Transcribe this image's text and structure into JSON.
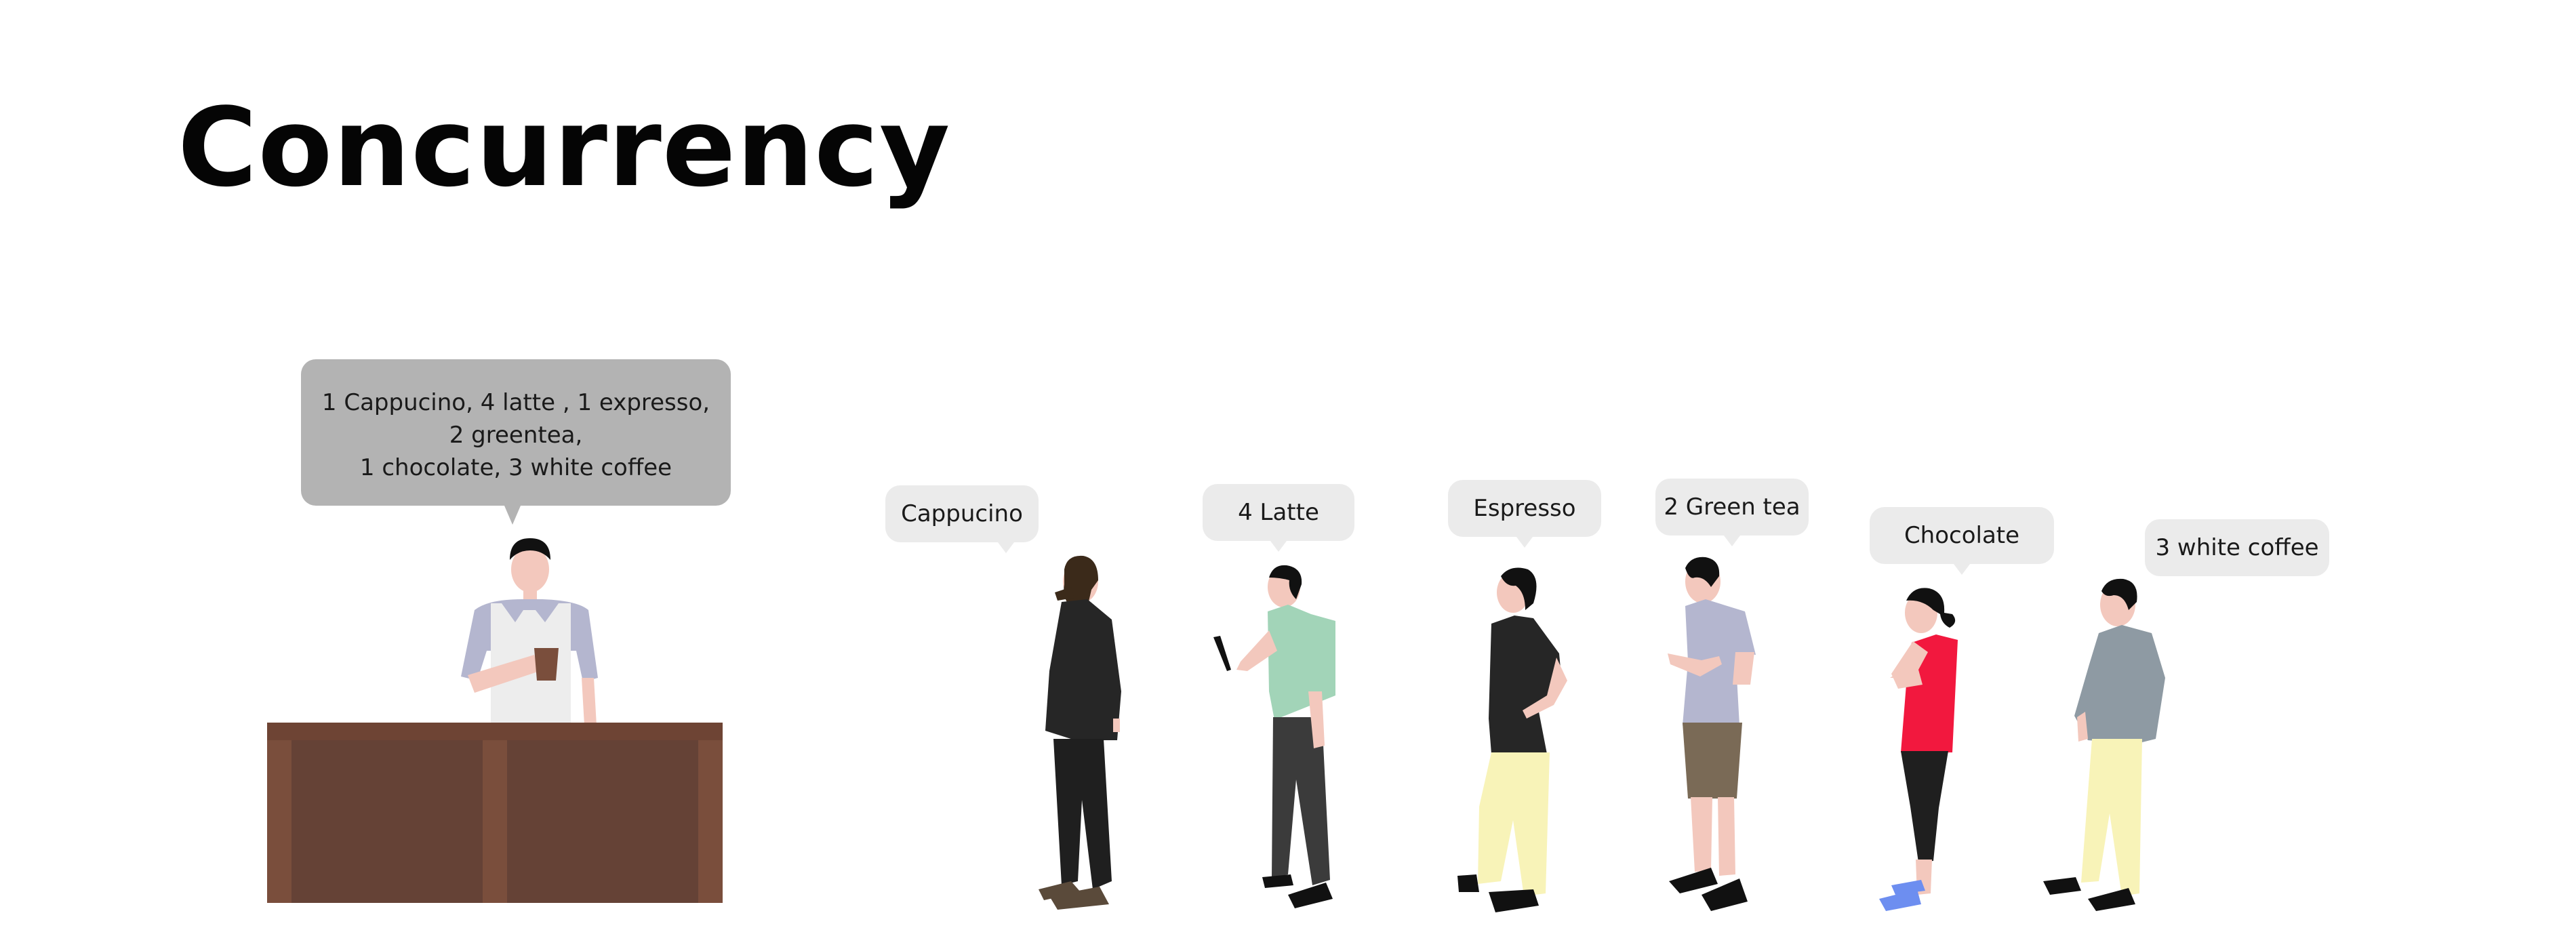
{
  "title": "Concurrency",
  "barista": {
    "order_lines": [
      "1 Cappucino, 4 latte , 1 expresso,",
      "2 greentea,",
      "1 chocolate, 3 white coffee"
    ]
  },
  "customers": [
    {
      "order": "Cappucino"
    },
    {
      "order": "4 Latte"
    },
    {
      "order": "Espresso"
    },
    {
      "order": "2 Green tea"
    },
    {
      "order": "Chocolate"
    },
    {
      "order": "3 white coffee"
    }
  ],
  "colors": {
    "counter": "#7a4e3c",
    "counter_panel": "#654236",
    "bubble_barista": "#b3b3b3",
    "bubble_customer": "#ebebeb",
    "skin": "#f3c8bd"
  }
}
